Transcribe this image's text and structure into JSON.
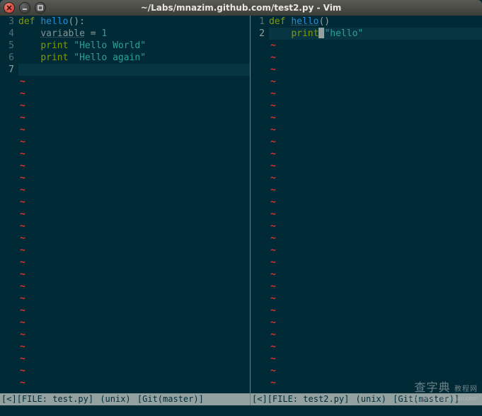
{
  "window": {
    "title": "~/Labs/mnazim.github.com/test2.py - Vim"
  },
  "panes": {
    "left": {
      "lines": [
        {
          "num": "3",
          "tokens": [
            {
              "cls": "kw",
              "t": "def "
            },
            {
              "cls": "fn",
              "t": "hello"
            },
            {
              "cls": "punct",
              "t": "():"
            }
          ]
        },
        {
          "num": "4",
          "tokens": [
            {
              "cls": "",
              "t": "    "
            },
            {
              "cls": "var undef",
              "t": "variable"
            },
            {
              "cls": "var",
              "t": " "
            },
            {
              "cls": "punct",
              "t": "="
            },
            {
              "cls": "var",
              "t": " "
            },
            {
              "cls": "num",
              "t": "1"
            }
          ]
        },
        {
          "num": "5",
          "tokens": [
            {
              "cls": "",
              "t": "    "
            },
            {
              "cls": "kw",
              "t": "print"
            },
            {
              "cls": "var",
              "t": " "
            },
            {
              "cls": "str",
              "t": "\"Hello World\""
            }
          ]
        },
        {
          "num": "6",
          "tokens": [
            {
              "cls": "",
              "t": "    "
            },
            {
              "cls": "kw",
              "t": "print"
            },
            {
              "cls": "var",
              "t": " "
            },
            {
              "cls": "str",
              "t": "\"Hello again\""
            }
          ]
        },
        {
          "num": "7",
          "tokens": []
        }
      ],
      "cursorline_index": 4,
      "tilde_count": 26,
      "status": {
        "arrow": "[<]",
        "file_label": "[FILE: ",
        "file_name": "test.py",
        "file_close": "]",
        "format": "(unix)",
        "git": "[Git(master)]"
      }
    },
    "right": {
      "lines": [
        {
          "num": "1",
          "tokens": [
            {
              "cls": "kw",
              "t": "def "
            },
            {
              "cls": "fn undef",
              "t": "hello"
            },
            {
              "cls": "punct",
              "t": "()"
            }
          ]
        },
        {
          "num": "2",
          "tokens": [
            {
              "cls": "",
              "t": "    "
            },
            {
              "cls": "kw",
              "t": "print"
            },
            {
              "cls": "cursor",
              "t": ""
            },
            {
              "cls": "str",
              "t": "\"hello\""
            }
          ]
        }
      ],
      "cursorline_index": 1,
      "tilde_count": 29,
      "status": {
        "arrow": "[<]",
        "file_label": "[FILE: ",
        "file_name": "test2.py",
        "file_close": "]",
        "format": "(unix)",
        "git": "[Git(master)]"
      }
    }
  },
  "watermark": {
    "line1a": "查字典",
    "line1b": "教程网",
    "line2": "jiaocheng.chazidian.com"
  }
}
